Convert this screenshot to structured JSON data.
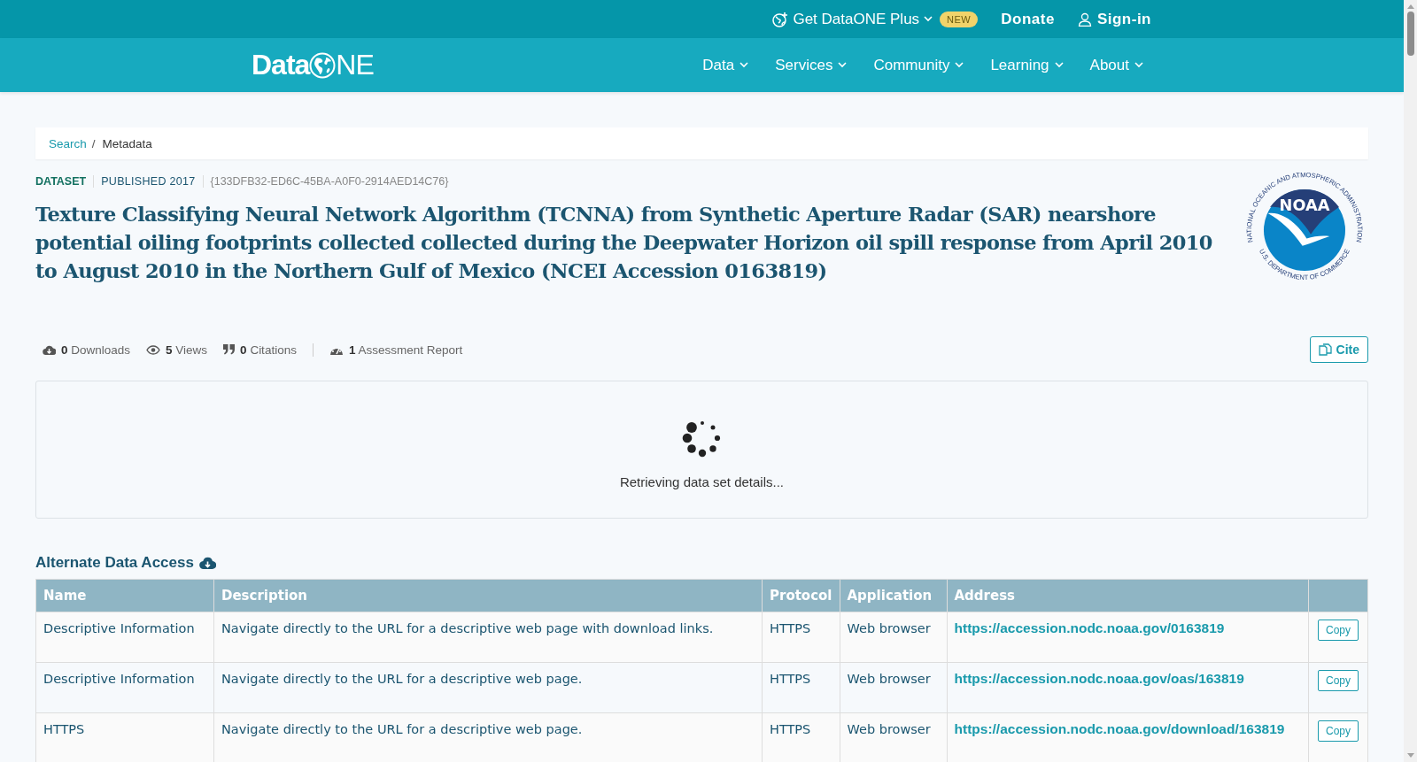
{
  "top_bar": {
    "plus_link": "Get DataONE Plus",
    "new_badge": "NEW",
    "donate": "Donate",
    "sign_in": "Sign-in"
  },
  "logo": {
    "left": "Data",
    "right": "NE"
  },
  "nav": [
    {
      "label": "Data"
    },
    {
      "label": "Services"
    },
    {
      "label": "Community"
    },
    {
      "label": "Learning"
    },
    {
      "label": "About"
    }
  ],
  "breadcrumb": [
    {
      "label": "Search",
      "kind": "link"
    },
    {
      "label": "/",
      "kind": "separator"
    },
    {
      "label": "Metadata",
      "kind": "current"
    }
  ],
  "meta": {
    "type": "DATASET",
    "published": "PUBLISHED 2017",
    "identifier": "{133DFB32-ED6C-45BA-A0F0-2914AED14C76}"
  },
  "title": "Texture Classifying Neural Network Algorithm (TCNNA) from Synthetic Aperture Radar (SAR) nearshore potential oiling footprints collected collected during the Deepwater Horizon oil spill response from April 2010 to August 2010 in the Northern Gulf of Mexico (NCEI Accession 0163819)",
  "org_logo": {
    "name": "NOAA",
    "ring_top": "NATIONAL OCEANIC AND ATMOSPHERIC ADMINISTRATION",
    "ring_bottom": "U.S. DEPARTMENT OF COMMERCE"
  },
  "metrics": [
    {
      "kind": "downloads",
      "count": "0",
      "label": "Downloads"
    },
    {
      "kind": "views",
      "count": "5",
      "label": "Views"
    },
    {
      "kind": "citations",
      "count": "0",
      "label": "Citations"
    },
    {
      "kind": "assessment",
      "count": "1",
      "label": "Assessment Report"
    }
  ],
  "cite_button": "Cite",
  "loading_message": "Retrieving data set details...",
  "alternate_access": {
    "heading": "Alternate Data Access",
    "columns": [
      "Name",
      "Description",
      "Protocol",
      "Application",
      "Address"
    ],
    "rows": [
      {
        "name": "Descriptive Information",
        "description": "Navigate directly to the URL for a descriptive web page with download links.",
        "protocol": "HTTPS",
        "application": "Web browser",
        "address": "https://accession.nodc.noaa.gov/0163819",
        "copy": "Copy"
      },
      {
        "name": "Descriptive Information",
        "description": "Navigate directly to the URL for a descriptive web page.",
        "protocol": "HTTPS",
        "application": "Web browser",
        "address": "https://accession.nodc.noaa.gov/oas/163819",
        "copy": "Copy"
      },
      {
        "name": "HTTPS",
        "description": "Navigate directly to the URL for a descriptive web page.",
        "protocol": "HTTPS",
        "application": "Web browser",
        "address": "https://accession.nodc.noaa.gov/download/163819",
        "copy": "Copy"
      }
    ]
  }
}
